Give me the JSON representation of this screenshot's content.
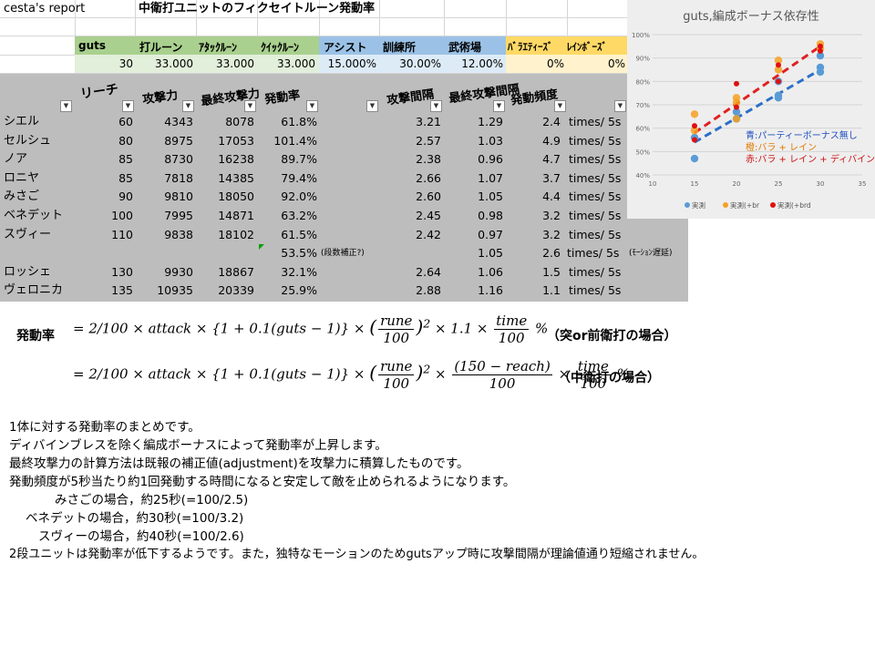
{
  "sheet": {
    "title": "cesta's report",
    "subtitle": "中衛打ユニットのフィクセイトルーン発動率",
    "param_headers": [
      "guts",
      "打ルーン",
      "ｱﾀｯｸﾙｰﾝ",
      "ｸｲｯｸﾙｰﾝ",
      "アシスト",
      "訓練所",
      "武術場",
      "ﾊﾞﾗｴﾃｨｰｽﾞ",
      "ﾚｲﾝﾎﾞｰｽﾞ"
    ],
    "param_values": [
      "30",
      "33.000",
      "33.000",
      "33.000",
      "15.000%",
      "30.00%",
      "12.00%",
      "0%",
      "0%"
    ],
    "col_headers": [
      "リーチ",
      "攻撃力",
      "最終攻撃力",
      "発動率",
      "攻撃間隔",
      "最終攻撃間隔",
      "発動頻度"
    ],
    "rows": [
      [
        "シエル",
        "60",
        "4343",
        "8078",
        "61.8%",
        "",
        "3.21",
        "1.29",
        "2.4",
        "times/ 5s",
        ""
      ],
      [
        "セルシュ",
        "80",
        "8975",
        "17053",
        "101.4%",
        "",
        "2.57",
        "1.03",
        "4.9",
        "times/ 5s",
        ""
      ],
      [
        "ノア",
        "85",
        "8730",
        "16238",
        "89.7%",
        "",
        "2.38",
        "0.96",
        "4.7",
        "times/ 5s",
        ""
      ],
      [
        "ロニヤ",
        "85",
        "7818",
        "14385",
        "79.4%",
        "",
        "2.66",
        "1.07",
        "3.7",
        "times/ 5s",
        ""
      ],
      [
        "みさご",
        "90",
        "9810",
        "18050",
        "92.0%",
        "",
        "2.60",
        "1.05",
        "4.4",
        "times/ 5s",
        ""
      ],
      [
        "ベネデット",
        "100",
        "7995",
        "14871",
        "63.2%",
        "",
        "2.45",
        "0.98",
        "3.2",
        "times/ 5s",
        ""
      ],
      [
        "スヴィー",
        "110",
        "9838",
        "18102",
        "61.5%",
        "",
        "2.42",
        "0.97",
        "3.2",
        "times/ 5s",
        ""
      ],
      [
        "",
        "",
        "",
        "",
        "53.5%",
        "(段数補正?)",
        "",
        "1.05",
        "2.6",
        "times/ 5s",
        "(ﾓｰｼｮﾝ遅延)"
      ],
      [
        "ロッシェ",
        "130",
        "9930",
        "18867",
        "32.1%",
        "",
        "2.64",
        "1.06",
        "1.5",
        "times/ 5s",
        ""
      ],
      [
        "ヴェロニカ",
        "135",
        "10935",
        "20339",
        "25.9%",
        "",
        "2.88",
        "1.16",
        "1.1",
        "times/ 5s",
        ""
      ]
    ]
  },
  "chart_data": {
    "type": "scatter",
    "title": "guts,編成ボーナス依存性",
    "xlim": [
      10,
      35
    ],
    "ylim": [
      40,
      100
    ],
    "x_ticks": [
      "10",
      "15",
      "20",
      "25",
      "30",
      "35"
    ],
    "y_ticks": [
      "40%",
      "50%",
      "60%",
      "70%",
      "80%",
      "90%",
      "100%"
    ],
    "grid": true,
    "legend_position": "bottom",
    "series": [
      {
        "name": "実測",
        "color": "#5b9bd5",
        "points": [
          [
            15,
            47
          ],
          [
            15,
            56
          ],
          [
            20,
            64
          ],
          [
            20,
            67
          ],
          [
            25,
            73
          ],
          [
            25,
            74
          ],
          [
            25,
            80
          ],
          [
            30,
            84
          ],
          [
            30,
            86
          ],
          [
            30,
            91
          ]
        ]
      },
      {
        "name": "実測(+br",
        "color": "#f4a020",
        "points": [
          [
            15,
            59
          ],
          [
            15,
            66
          ],
          [
            20,
            64
          ],
          [
            20,
            71
          ],
          [
            20,
            73
          ],
          [
            25,
            85
          ],
          [
            25,
            89
          ],
          [
            30,
            94
          ],
          [
            30,
            96
          ]
        ]
      },
      {
        "name": "実測(+brd",
        "color": "#e01010",
        "points": [
          [
            15,
            55
          ],
          [
            15,
            61
          ],
          [
            20,
            69
          ],
          [
            20,
            79
          ],
          [
            25,
            80
          ],
          [
            25,
            87
          ],
          [
            30,
            93
          ],
          [
            30,
            95
          ]
        ]
      }
    ],
    "trendlines": [
      {
        "color": "#2a6fc9",
        "from": [
          15,
          54
        ],
        "to": [
          30,
          85
        ]
      },
      {
        "color": "#e02020",
        "from": [
          15,
          58
        ],
        "to": [
          30,
          95
        ]
      }
    ],
    "annotations": [
      {
        "text": "青:パーティーボーナス無し",
        "color": "#1f4fbf"
      },
      {
        "text": "橙:バラ + レイン",
        "color": "#e07a00"
      },
      {
        "text": "赤:バラ + レイン + ディバイン",
        "color": "#d01010"
      }
    ]
  },
  "formulas": {
    "label": "発動率",
    "line1_caption": "（突or前衛打の場合）",
    "line2_caption": "（中衛打の場合）",
    "f1": {
      "lhs": "= 2/100 × attack × {1 + 0.1(guts − 1)} × ",
      "rune_num": "rune",
      "den": "100",
      "exp": "2",
      "mid": " × 1.1 × ",
      "time_num": "time",
      "time_den": "100",
      "tail": " %"
    },
    "f2": {
      "lhs": "= 2/100 × attack × {1 + 0.1(guts − 1)} × ",
      "rune_num": "rune",
      "den": "100",
      "exp": "2",
      "reach_num": "(150 − reach)",
      "reach_den": "100",
      "time_num": "time",
      "time_den": "100",
      "tail": " %"
    }
  },
  "notes": [
    "1体に対する発動率のまとめです。",
    "ディバインブレスを除く編成ボーナスによって発動率が上昇します。",
    "最終攻撃力の計算方法は既報の補正値(adjustment)を攻撃力に積算したものです。",
    "発動頻度が5秒当たり約1回発動する時間になると安定して敵を止められるようになります。",
    "みさごの場合，約25秒(=100/2.5)",
    "ベネデットの場合，約30秒(=100/3.2)",
    "スヴィーの場合，約40秒(=100/2.6)",
    "2段ユニットは発動率が低下するようです。また，独特なモーションのためgutsアップ時に攻撃間隔が理論値通り短縮されません。"
  ]
}
